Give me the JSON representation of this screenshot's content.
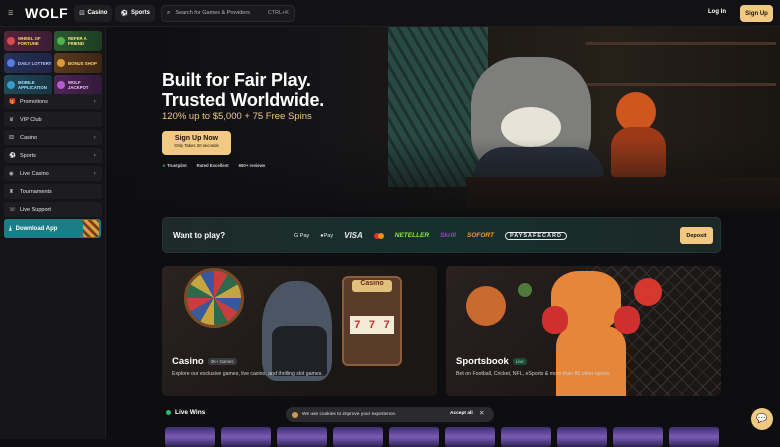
{
  "header": {
    "logo_text": "WOLF",
    "nav": [
      {
        "label": "Casino",
        "icon": "dice-icon"
      },
      {
        "label": "Sports",
        "icon": "ball-icon"
      }
    ],
    "search_placeholder": "Search for Games & Providers",
    "search_shortcut": "CTRL+K",
    "login_label": "Log In",
    "signup_label": "Sign Up"
  },
  "sidebar": {
    "promos": [
      {
        "label": "WHEEL OF FORTUNE"
      },
      {
        "label": "REFER A FRIEND"
      },
      {
        "label": "DAILY LOTTERY"
      },
      {
        "label": "BONUS SHOP"
      },
      {
        "label": "MOBILE APPLICATION"
      },
      {
        "label": "WOLF JACKPOT"
      }
    ],
    "items": [
      {
        "label": "Promotions",
        "icon": "gift-icon",
        "chevron": true
      },
      {
        "label": "VIP Club",
        "icon": "crown-icon",
        "chevron": false
      },
      {
        "label": "Casino",
        "icon": "dice-icon",
        "chevron": true
      },
      {
        "label": "Sports",
        "icon": "ball-icon",
        "chevron": true
      },
      {
        "label": "Live Casino",
        "icon": "live-icon",
        "chevron": true
      },
      {
        "label": "Tournaments",
        "icon": "trophy-icon",
        "chevron": false
      },
      {
        "label": "Live Support",
        "icon": "headset-icon",
        "chevron": false
      }
    ],
    "download_label": "Download App"
  },
  "hero": {
    "headline_1": "Built for Fair Play.",
    "headline_2": "Trusted Worldwide.",
    "offer": "120% up to $5,000 + 75 Free Spins",
    "cta_label": "Sign Up Now",
    "cta_sub": "Only Takes 30 seconds",
    "trustpilot": "Trustpilot",
    "rated": "Rated Excellent",
    "reviews": "650+ reviews"
  },
  "payments": {
    "question": "Want to play?",
    "methods": [
      "G Pay",
      "Pay",
      "VISA",
      "",
      "NETELLER",
      "Skrill",
      "SOFORT",
      "PAYSAFECARD"
    ],
    "deposit_label": "Deposit"
  },
  "cards": {
    "casino": {
      "title": "Casino",
      "tag": "3K+ Games",
      "slot_name": "Casino",
      "slot_symbols": [
        "7",
        "7",
        "7"
      ],
      "description": "Explore our exclusive games, live casino, and thrilling slot games."
    },
    "sports": {
      "title": "Sportsbook",
      "tag": "Live",
      "description": "Bet on Football, Cricket, NFL, eSports & more than 80 other sports."
    }
  },
  "live_wins": {
    "title": "Live Wins"
  },
  "cookie": {
    "text": "We use cookies to improve your experience.",
    "accept_label": "Accept all",
    "close": "✕"
  },
  "colors": {
    "accent": "#f1c982",
    "teal": "#1b7d86",
    "bg": "#0e0e10"
  }
}
